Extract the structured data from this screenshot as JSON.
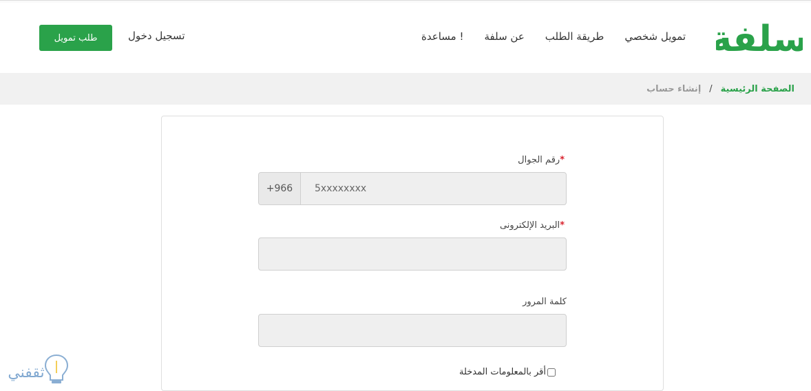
{
  "header": {
    "logo_text": "سلفة",
    "nav": [
      "تمويل شخصي",
      "طريقة الطلب",
      "عن سلفة",
      "مساعدة !"
    ],
    "login": "تسجيل دخول",
    "cta": "طلب تمويل"
  },
  "breadcrumb": {
    "home": "الصفحة الرئيسية",
    "separator": "/",
    "current": "إنشاء حساب"
  },
  "form": {
    "phone_label": "رقم الجوال",
    "phone_prefix": "+966",
    "phone_placeholder": "5xxxxxxxx",
    "email_label": "البريد الإلكترونى",
    "password_label": "كلمة المرور",
    "required_mark": "*",
    "agree_label": "أقر بالمعلومات المدخلة"
  },
  "watermark_text": "ثقفني",
  "colors": {
    "brand_green": "#2aa24a",
    "required_red": "#d9232e",
    "field_bg": "#efefef"
  }
}
